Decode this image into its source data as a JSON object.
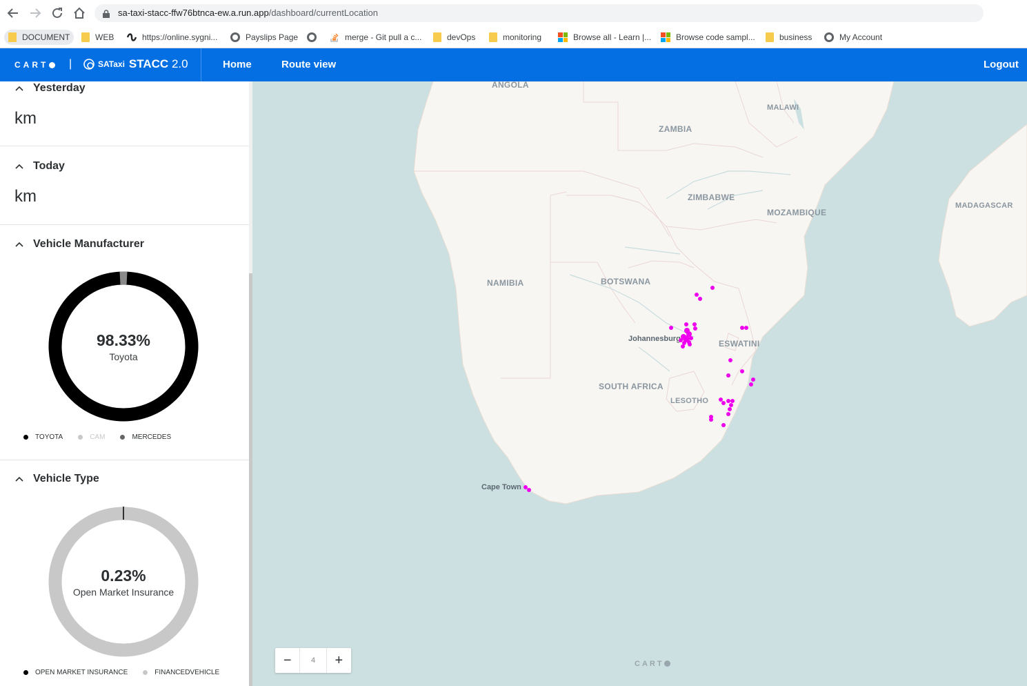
{
  "browser": {
    "url_host": "sa-taxi-stacc-ffw76btnca-ew.a.run.app",
    "url_path": "/dashboard/currentLocation",
    "bookmarks": [
      {
        "label": "DOCUMENT",
        "icon": "folder-icon"
      },
      {
        "label": "WEB",
        "icon": "folder-icon"
      },
      {
        "label": "https://online.sygni...",
        "icon": "sygnia-icon"
      },
      {
        "label": "Payslips Page",
        "icon": "globe-icon"
      },
      {
        "label": "",
        "icon": "globe-icon"
      },
      {
        "label": "merge - Git pull a c...",
        "icon": "stackoverflow-icon"
      },
      {
        "label": "devOps",
        "icon": "folder-icon"
      },
      {
        "label": "monitoring",
        "icon": "folder-icon"
      },
      {
        "label": "Browse all - Learn |...",
        "icon": "microsoft-icon"
      },
      {
        "label": "Browse code sampl...",
        "icon": "microsoft-icon"
      },
      {
        "label": "business",
        "icon": "folder-icon"
      },
      {
        "label": "My Account",
        "icon": "globe-icon"
      }
    ]
  },
  "header": {
    "carto": "CART",
    "separator": "|",
    "brand_sa": "SATaxi",
    "brand_stacc": "STACC",
    "brand_version": "2.0",
    "nav": [
      {
        "label": "Home"
      },
      {
        "label": "Route view"
      }
    ],
    "logout": "Logout"
  },
  "sidebar": {
    "yesterday": {
      "title": "Yesterday",
      "value": "km"
    },
    "today": {
      "title": "Today",
      "value": "km"
    },
    "manufacturer": {
      "title": "Vehicle Manufacturer",
      "center_value": "98.33%",
      "center_label": "Toyota",
      "legend": [
        {
          "label": "TOYOTA",
          "color": "#000000"
        },
        {
          "label": "CAM",
          "color": "#c8c8c8"
        },
        {
          "label": "MERCEDES",
          "color": "#666666"
        }
      ]
    },
    "vehicle_type": {
      "title": "Vehicle Type",
      "center_value": "0.23%",
      "center_label": "Open Market Insurance",
      "legend": [
        {
          "label": "OPEN MARKET INSURANCE",
          "color": "#000000"
        },
        {
          "label": "FINANCEDVEHICLE",
          "color": "#c8c8c8"
        }
      ]
    }
  },
  "map": {
    "labels": {
      "angola": "ANGOLA",
      "zambia": "ZAMBIA",
      "malawi": "MALAWI",
      "zimbabwe": "ZIMBABWE",
      "mozambique": "MOZAMBIQUE",
      "madagascar": "MADAGASCAR",
      "namibia": "NAMIBIA",
      "botswana": "BOTSWANA",
      "eswatini": "ESWATINI",
      "south_africa": "SOUTH AFRICA",
      "lesotho": "LESOTHO",
      "johannesburg": "Johannesburg",
      "cape_town": "Cape Town"
    },
    "zoom_level": "4",
    "zoom_out": "−",
    "zoom_in": "+",
    "attribution": "CART",
    "marker_color": "#ee00ee"
  },
  "colors": {
    "header_blue": "#036fe2",
    "water": "#cde0e1",
    "land": "#f8f6f2"
  }
}
